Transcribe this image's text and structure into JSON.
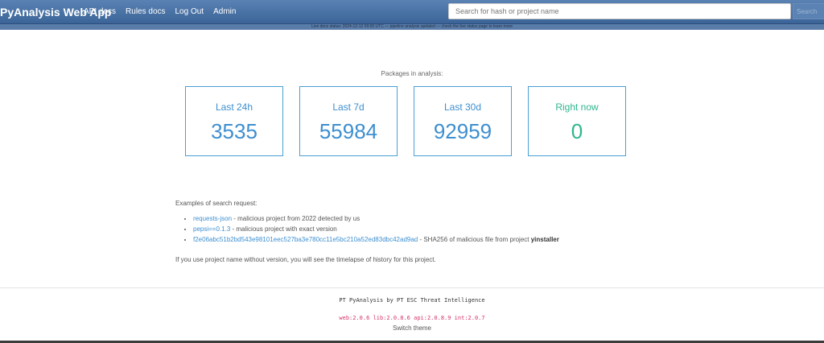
{
  "navbar": {
    "brand": "PyAnalysis Web App",
    "links": [
      "API docs",
      "Rules docs",
      "Log Out",
      "Admin"
    ],
    "search_placeholder": "Search for hash or project name",
    "search_button": "Search"
  },
  "notice": {
    "text": "Live docs status: 2024-12-12 09:00 UTC — pipeline analysis updated — check the live status page to learn more"
  },
  "stats": {
    "label": "Packages in analysis:",
    "cards": [
      {
        "title": "Last 24h",
        "value": "3535"
      },
      {
        "title": "Last 7d",
        "value": "55984"
      },
      {
        "title": "Last 30d",
        "value": "92959"
      },
      {
        "title": "Right now",
        "value": "0"
      }
    ]
  },
  "examples": {
    "heading": "Examples of search request:",
    "items": [
      {
        "link": "requests-json",
        "text": " - malicious project from 2022 detected by us",
        "bold": ""
      },
      {
        "link": "pepsi==0.1.3",
        "text": " - malicious project with exact version",
        "bold": ""
      },
      {
        "link": "f2e06abc51b2bd543e98101eec527ba3e780cc11e5bc210a52ed83dbc42ad9ad",
        "text": " - SHA256 of malicious file from project ",
        "bold": "yinstaller"
      }
    ],
    "note": "If you use project name without version, you will see the timelapse of history for this project."
  },
  "footer": {
    "line1": "PT PyAnalysis by PT ESC Threat Intelligence",
    "versions": "web:2.0.6 lib:2.0.8.6 api:2.0.8.9 int:2.0.7",
    "switch_theme": "Switch theme"
  },
  "colors": {
    "navbar": "#3b6498",
    "accent_blue": "#3d8fd0",
    "accent_green": "#2fb58e",
    "versions_pink": "#d6336c"
  }
}
